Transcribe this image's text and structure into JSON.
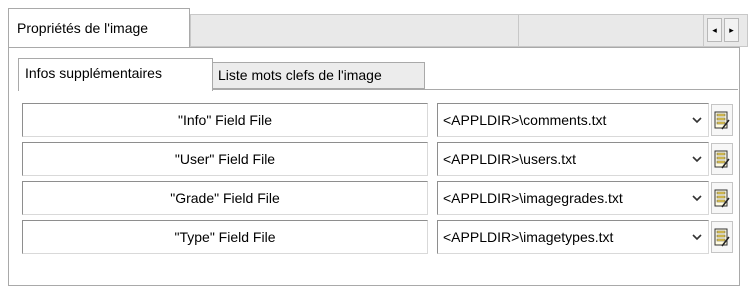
{
  "window_tab": {
    "label": "Propriétés de l'image",
    "scroll_left": "◂",
    "scroll_right": "▸"
  },
  "sub_tabs": [
    {
      "label": "Infos supplémentaires",
      "active": true
    },
    {
      "label": "Liste mots clefs de l'image",
      "active": false
    }
  ],
  "rows": [
    {
      "label": "\"Info\" Field File",
      "value": "<APPLDIR>\\comments.txt",
      "icon": "edit-file-icon"
    },
    {
      "label": "\"User\" Field File",
      "value": "<APPLDIR>\\users.txt",
      "icon": "edit-file-icon"
    },
    {
      "label": "\"Grade\" Field File",
      "value": "<APPLDIR>\\imagegrades.txt",
      "icon": "edit-file-icon"
    },
    {
      "label": "\"Type\" Field File",
      "value": "<APPLDIR>\\imagetypes.txt",
      "icon": "edit-file-icon"
    }
  ],
  "colors": {
    "border": "#a9a9a9",
    "inactive_tab": "#ececec",
    "icon_yellow": "#f3d34a"
  }
}
